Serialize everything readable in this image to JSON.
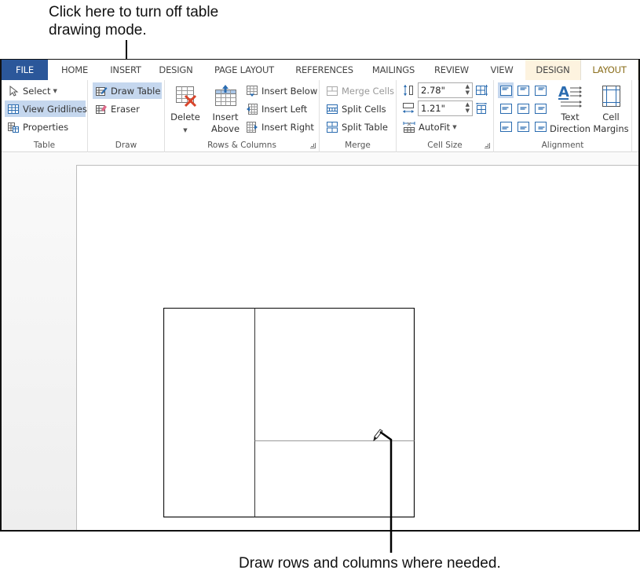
{
  "callouts": {
    "top": "Click here to turn off table drawing mode.",
    "bottom": "Draw rows and columns where needed."
  },
  "tabs": [
    {
      "label": "FILE",
      "type": "file"
    },
    {
      "label": "HOME"
    },
    {
      "label": "INSERT"
    },
    {
      "label": "DESIGN"
    },
    {
      "label": "PAGE LAYOUT"
    },
    {
      "label": "REFERENCES"
    },
    {
      "label": "MAILINGS"
    },
    {
      "label": "REVIEW"
    },
    {
      "label": "VIEW"
    },
    {
      "label": "DESIGN",
      "type": "contextual"
    },
    {
      "label": "LAYOUT",
      "type": "contextual-active"
    }
  ],
  "ribbon": {
    "table": {
      "label": "Table",
      "select": "Select",
      "view_gridlines": "View Gridlines",
      "properties": "Properties"
    },
    "draw": {
      "label": "Draw",
      "draw_table": "Draw Table",
      "eraser": "Eraser"
    },
    "rows_columns": {
      "label": "Rows & Columns",
      "delete": "Delete",
      "insert_above_1": "Insert",
      "insert_above_2": "Above",
      "insert_below": "Insert Below",
      "insert_left": "Insert Left",
      "insert_right": "Insert Right"
    },
    "merge": {
      "label": "Merge",
      "merge_cells": "Merge Cells",
      "split_cells": "Split Cells",
      "split_table": "Split Table"
    },
    "cell_size": {
      "label": "Cell Size",
      "height_value": "2.78\"",
      "width_value": "1.21\"",
      "autofit": "AutoFit"
    },
    "alignment": {
      "label": "Alignment",
      "text_direction_1": "Text",
      "text_direction_2": "Direction",
      "cell_margins_1": "Cell",
      "cell_margins_2": "Margins"
    }
  },
  "colors": {
    "file_tab": "#2b579a",
    "contextual_tab_bg": "#fdf3df",
    "layout_tab_text": "#8a6d1a",
    "active_button": "#c5d7ee",
    "icon_blue": "#2b6cb0",
    "icon_red": "#d9452b"
  }
}
